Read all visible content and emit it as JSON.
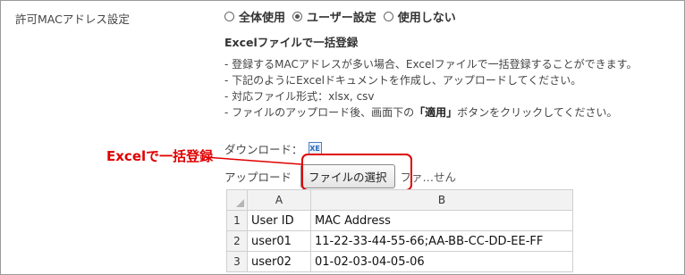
{
  "setting_label": "許可MACアドレス設定",
  "mode": {
    "options": [
      {
        "label": "全体使用",
        "checked": false
      },
      {
        "label": "ユーザー設定",
        "checked": true
      },
      {
        "label": "使用しない",
        "checked": false
      }
    ]
  },
  "bulk": {
    "title": "Excelファイルで一括登録",
    "notes": [
      "- 登録するMACアドレスが多い場合、Excelファイルで一括登録することができます。",
      "- 下記のようにExcelドキュメントを作成し、アップロードしてください。",
      "- 対応ファイル形式：xlsx, csv"
    ],
    "note4_prefix": "- ファイルのアップロード後、画面下の",
    "note4_bold": "「適用」",
    "note4_suffix": "ボタンをクリックしてください。"
  },
  "download": {
    "label": "ダウンロード：",
    "icon": "excel-file-icon"
  },
  "upload": {
    "label": "アップロード",
    "button": "ファイルの選択",
    "status": "ファ…せん"
  },
  "annotation": {
    "text": "Excelで一括登録",
    "color": "#e00000"
  },
  "sheet": {
    "columns": [
      "A",
      "B"
    ],
    "rows": [
      {
        "num": "1",
        "a": "User ID",
        "b": "MAC Address"
      },
      {
        "num": "2",
        "a": "user01",
        "b": "11-22-33-44-55-66;AA-BB-CC-DD-EE-FF"
      },
      {
        "num": "3",
        "a": "user02",
        "b": "01-02-03-04-05-06"
      }
    ]
  }
}
